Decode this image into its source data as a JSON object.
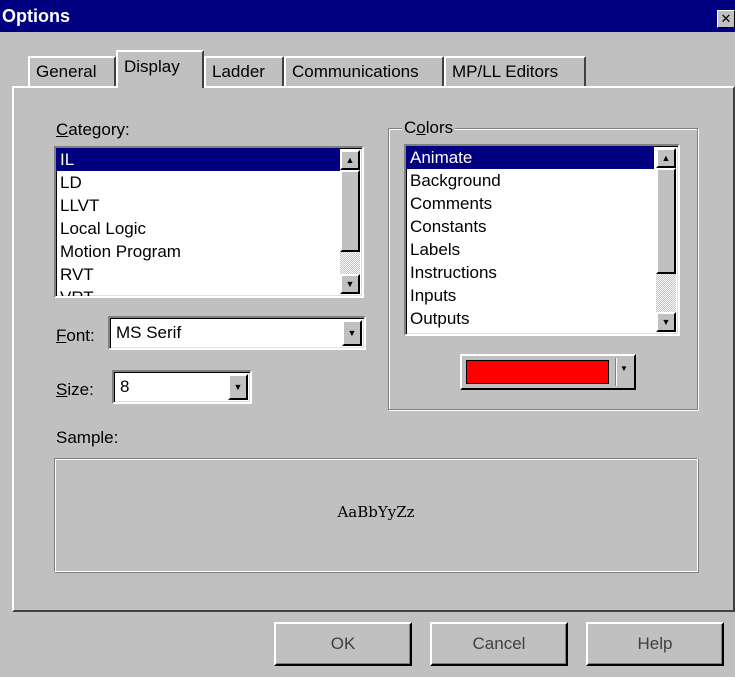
{
  "window": {
    "title": "Options",
    "close_glyph": "✕"
  },
  "tabs": [
    {
      "label": "General",
      "active": false
    },
    {
      "label": "Display",
      "active": true
    },
    {
      "label": "Ladder",
      "active": false
    },
    {
      "label": "Communications",
      "active": false
    },
    {
      "label": "MP/LL Editors",
      "active": false
    }
  ],
  "category": {
    "label_first": "C",
    "label_rest": "ategory:",
    "items": [
      "IL",
      "LD",
      "LLVT",
      "Local Logic",
      "Motion Program",
      "RVT",
      "VRT"
    ],
    "selected": "IL"
  },
  "font": {
    "label_first": "F",
    "label_rest": "ont:",
    "value": "MS Serif"
  },
  "size": {
    "label_first": "S",
    "label_rest": "ize:",
    "value": "8"
  },
  "colors": {
    "label_pre": "C",
    "label_u": "o",
    "label_rest": "lors",
    "items": [
      "Animate",
      "Background",
      "Comments",
      "Constants",
      "Labels",
      "Instructions",
      "Inputs",
      "Outputs"
    ],
    "selected": "Animate",
    "current_color": "#ff0000"
  },
  "sample": {
    "label": "Sample:",
    "text": "AaBbYyZz"
  },
  "buttons": {
    "ok": "OK",
    "cancel": "Cancel",
    "help": "Help"
  },
  "icons": {
    "scroll_up": "▲",
    "scroll_down": "▼",
    "dropdown": "▼"
  }
}
